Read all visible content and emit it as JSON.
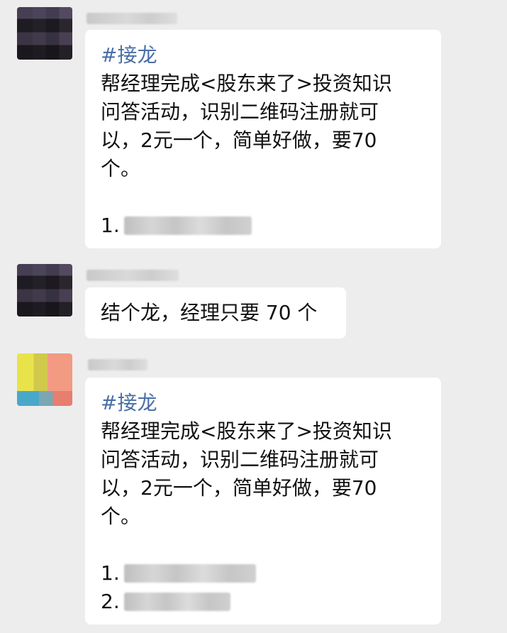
{
  "messages": [
    {
      "avatar_icon": "user-avatar-dark",
      "tag": "#接龙",
      "lines": [
        "帮经理完成<股东来了>投资知识",
        "问答活动，识别二维码注册就可",
        "以，2元一个，简单好做，要70",
        "个。"
      ],
      "list": [
        "1."
      ]
    },
    {
      "avatar_icon": "user-avatar-dark",
      "text": "结个龙，经理只要 70 个"
    },
    {
      "avatar_icon": "user-avatar-color",
      "tag": "#接龙",
      "lines": [
        "帮经理完成<股东来了>投资知识",
        "问答活动，识别二维码注册就可",
        "以，2元一个，简单好做，要70",
        "个。"
      ],
      "list": [
        "1.",
        "2."
      ]
    }
  ],
  "colors": {
    "background": "#ededed",
    "bubble": "#ffffff",
    "tag": "#4a6fa6",
    "text": "#111111"
  }
}
